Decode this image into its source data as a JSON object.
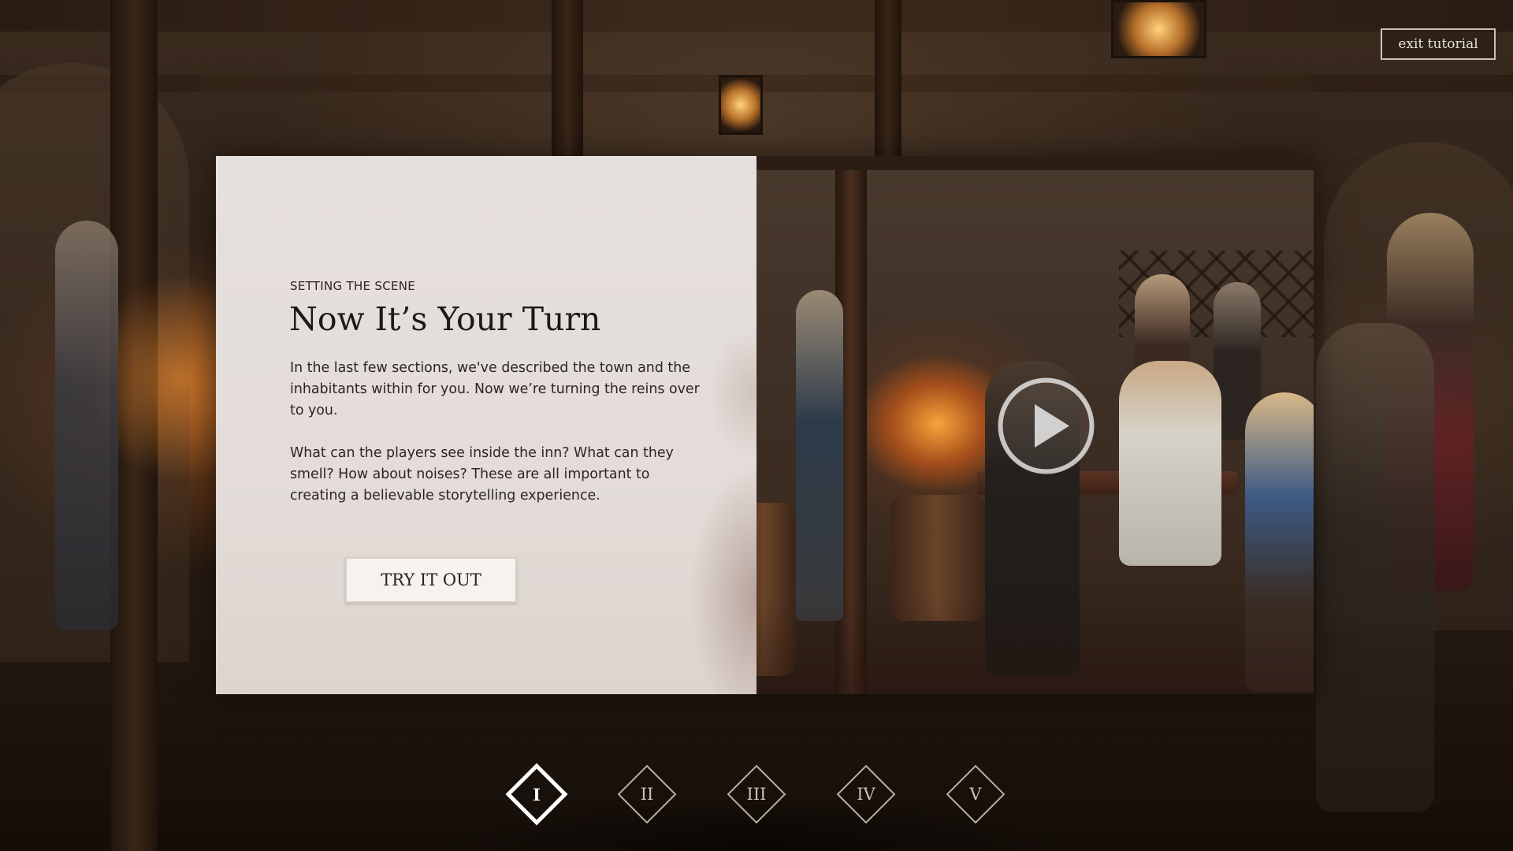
{
  "header": {
    "exit_label": "exit tutorial"
  },
  "panel": {
    "eyebrow": "SETTING THE SCENE",
    "title": "Now It’s Your Turn",
    "paragraphs": [
      "In the last few sections, we've described the town and the inhabitants within for you. Now we’re turning the reins over to you.",
      "What can the players see inside the inn? What can they smell? How about noises? These are all important to creating a believable storytelling experience."
    ],
    "cta_label": "TRY IT OUT"
  },
  "video": {
    "play_icon": "play-icon"
  },
  "steps": [
    {
      "label": "I",
      "active": true
    },
    {
      "label": "II",
      "active": false
    },
    {
      "label": "III",
      "active": false
    },
    {
      "label": "IV",
      "active": false
    },
    {
      "label": "V",
      "active": false
    }
  ],
  "colors": {
    "paper": "#e4ddd9",
    "text_dark": "#2c2521",
    "accent_light": "#e7e1d8"
  }
}
